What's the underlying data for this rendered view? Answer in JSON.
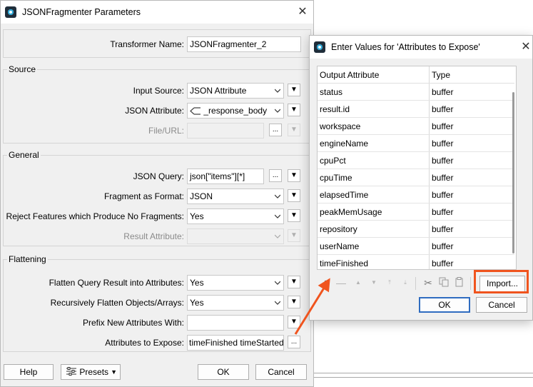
{
  "main_window": {
    "title": "JSONFragmenter Parameters",
    "transformer_name_label": "Transformer Name:",
    "transformer_name_value": "JSONFragmenter_2",
    "source": {
      "group_title": "Source",
      "input_source_label": "Input Source:",
      "input_source_value": "JSON Attribute",
      "json_attribute_label": "JSON Attribute:",
      "json_attribute_value": "_response_body",
      "file_url_label": "File/URL:",
      "file_url_value": ""
    },
    "general": {
      "group_title": "General",
      "json_query_label": "JSON Query:",
      "json_query_value": "json[\"items\"][*]",
      "fragment_format_label": "Fragment as Format:",
      "fragment_format_value": "JSON",
      "reject_label": "Reject Features which Produce No Fragments:",
      "reject_value": "Yes",
      "result_attribute_label": "Result Attribute:",
      "result_attribute_value": ""
    },
    "flattening": {
      "group_title": "Flattening",
      "flatten_label": "Flatten Query Result into Attributes:",
      "flatten_value": "Yes",
      "recursive_label": "Recursively Flatten Objects/Arrays:",
      "recursive_value": "Yes",
      "prefix_label": "Prefix New Attributes With:",
      "prefix_value": "",
      "expose_label": "Attributes to Expose:",
      "expose_value": "timeFinished timeStarted"
    },
    "footer": {
      "help_label": "Help",
      "presets_label": "Presets",
      "ok_label": "OK",
      "cancel_label": "Cancel"
    },
    "ellipsis": "...",
    "menu_arrow": "▼"
  },
  "dialog": {
    "title": "Enter Values for 'Attributes to Expose'",
    "columns": [
      "Output Attribute",
      "Type"
    ],
    "rows": [
      {
        "name": "status",
        "type": "buffer"
      },
      {
        "name": "result.id",
        "type": "buffer"
      },
      {
        "name": "workspace",
        "type": "buffer"
      },
      {
        "name": "engineName",
        "type": "buffer"
      },
      {
        "name": "cpuPct",
        "type": "buffer"
      },
      {
        "name": "cpuTime",
        "type": "buffer"
      },
      {
        "name": "elapsedTime",
        "type": "buffer"
      },
      {
        "name": "peakMemUsage",
        "type": "buffer"
      },
      {
        "name": "repository",
        "type": "buffer"
      },
      {
        "name": "userName",
        "type": "buffer"
      },
      {
        "name": "timeFinished",
        "type": "buffer"
      }
    ],
    "import_label": "Import...",
    "ok_label": "OK",
    "cancel_label": "Cancel"
  },
  "colors": {
    "highlight": "#f0541e",
    "accent": "#27a8d8"
  }
}
